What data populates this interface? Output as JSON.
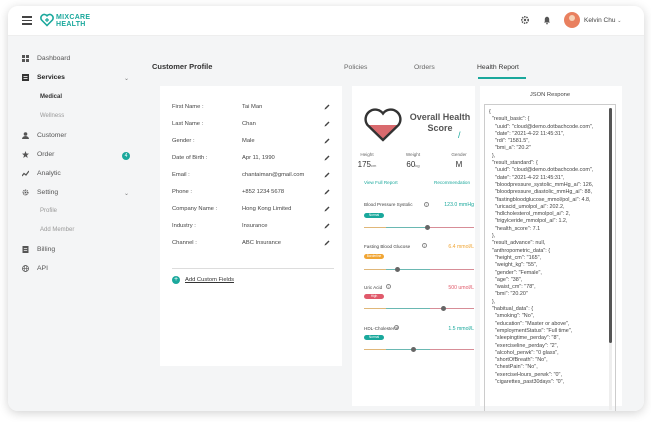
{
  "brand": {
    "line1": "MIXCARE",
    "line2": "HEALTH",
    "color": "#1aa89c"
  },
  "topbar": {
    "user_name": "Kelvin Chu",
    "icons": [
      "gear-icon",
      "bell-icon",
      "chevron-down-icon"
    ]
  },
  "sidebar": {
    "items": [
      {
        "label": "Dashboard",
        "icon": "dashboard-icon"
      },
      {
        "label": "Services",
        "icon": "services-icon"
      },
      {
        "label": "Medical"
      },
      {
        "label": "Wellness"
      },
      {
        "label": "Customer",
        "icon": "customer-icon"
      },
      {
        "label": "Order",
        "icon": "star-icon",
        "badge": "4"
      },
      {
        "label": "Analytic",
        "icon": "analytics-icon"
      },
      {
        "label": "Setting",
        "icon": "gear-icon"
      },
      {
        "label": "Profile"
      },
      {
        "label": "Add Member"
      },
      {
        "label": "Billing",
        "icon": "billing-icon"
      },
      {
        "label": "API",
        "icon": "globe-icon"
      }
    ]
  },
  "main": {
    "page_title": "Customer Profile",
    "tabs": [
      {
        "label": "Policies"
      },
      {
        "label": "Orders"
      },
      {
        "label": "Health Report",
        "active": true
      }
    ]
  },
  "profile": {
    "fields": [
      {
        "label": "First Name :",
        "value": "Tai Man"
      },
      {
        "label": "Last Name :",
        "value": "Chan"
      },
      {
        "label": "Gender :",
        "value": "Male"
      },
      {
        "label": "Date of Birth :",
        "value": "Apr 11, 1990"
      },
      {
        "label": "Email :",
        "value": "chantaiman@gmail.com"
      },
      {
        "label": "Phone :",
        "value": "+852 1234 5678"
      },
      {
        "label": "Company Name :",
        "value": "Hong Kong Limited"
      },
      {
        "label": "Industry :",
        "value": "Insurance"
      },
      {
        "label": "Channel :",
        "value": "ABC Insurance"
      }
    ],
    "add_fields_label": "Add Custom Fields"
  },
  "health": {
    "title": "Overall Health Score",
    "score": "/",
    "stats": [
      {
        "label": "Height",
        "value": "175",
        "unit": "cm"
      },
      {
        "label": "Weight",
        "value": "60",
        "unit": "kg"
      },
      {
        "label": "Gender",
        "value": "M",
        "unit": ""
      }
    ],
    "view_full_report": "View Full Report",
    "recommendation": "Recommendation",
    "metrics": [
      {
        "name": "Blood Pressure Systolic",
        "value": "123.0 mmHg",
        "status": "Normal",
        "status_color": "#1aa89c",
        "value_color": "#1aa89c",
        "level": 0.58
      },
      {
        "name": "Fasting Blood Glucose",
        "value": "6.4 mmol/L",
        "status": "Borderline",
        "status_color": "#f0a534",
        "value_color": "#f0a534",
        "level": 0.3
      },
      {
        "name": "Uric Acid",
        "value": "500 umol/L",
        "status": "High",
        "status_color": "#e05a6b",
        "value_color": "#e05a6b",
        "level": 0.72
      },
      {
        "name": "HDL-Cholesterol",
        "value": "1.5 mmol/L",
        "status": "Normal",
        "status_color": "#1aa89c",
        "value_color": "#1aa89c",
        "level": 0.45
      }
    ]
  },
  "json_panel": {
    "title": "JSON Respone",
    "lines": [
      "{",
      "  \"result_basic\": {",
      "    \"uuid\": \"cloud@demo.dotbachcode.com\",",
      "    \"date\": \"2021-4-22 11:45:31\",",
      "    \"rdi\": \"1581.5\",",
      "    \"bmi_a\": \"20.2\"",
      "  },",
      "  \"result_standard\": {",
      "    \"uuid\": \"cloud@demo.dotbachcode.com\",",
      "    \"date\": \"2021-4-22 11:45:31\",",
      "    \"bloodpressure_systolic_mmHg_ai\": 126,",
      "    \"bloodpressure_diastolic_mmHg_ai\": 88,",
      "    \"fastingbloodglucose_mmol/pol_ai\": 4.8,",
      "    \"uricacid_umolpol_ai\": 202.2,",
      "    \"hdlcholesterol_mmolpol_ai\": 2,",
      "    \"trigylceride_mmolpol_ai\": 1.2,",
      "    \"health_score\": 7.1",
      "  },",
      "  \"result_advance\": null,",
      "  \"anthropometric_data\": {",
      "    \"height_cm\": \"165\",",
      "    \"weight_kg\": \"55\",",
      "    \"gender\": \"Female\",",
      "    \"age\": \"38\",",
      "    \"waist_cm\": \"78\",",
      "    \"bmi\": \"20.20\"",
      "  },",
      "  \"habitual_data\": {",
      "    \"smoking\": \"No\",",
      "    \"education\": \"Master or above\",",
      "    \"employmentStatus\": \"Full time\",",
      "    \"sleepingtime_perday\": \"8\",",
      "    \"exerciseline_perday\": \"2\",",
      "    \"alcohol_perwk\": \"0 glass\",",
      "    \"shortOfBreath\": \"No\",",
      "    \"chestPain\": \"No\",",
      "    \"exerciseHours_perwk\": \"0\",",
      "    \"cigarettes_past30days\": \"0\","
    ]
  }
}
